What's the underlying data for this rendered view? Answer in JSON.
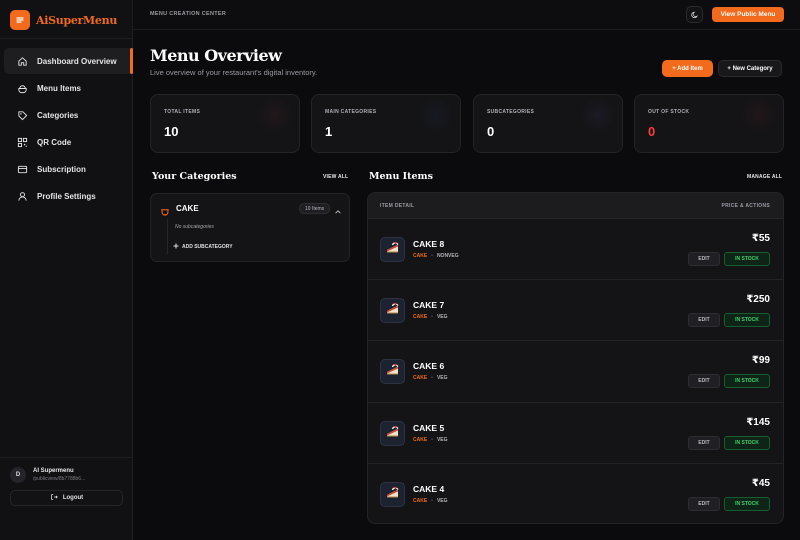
{
  "app": {
    "name": "AiSuperMenu"
  },
  "sidebar": {
    "items": [
      {
        "label": "Dashboard Overview",
        "icon": "home-icon"
      },
      {
        "label": "Menu Items",
        "icon": "bowl-icon"
      },
      {
        "label": "Categories",
        "icon": "tag-icon"
      },
      {
        "label": "QR Code",
        "icon": "qr-icon"
      },
      {
        "label": "Subscription",
        "icon": "card-icon"
      },
      {
        "label": "Profile Settings",
        "icon": "user-icon"
      }
    ],
    "active_index": 0,
    "user": {
      "initial": "D",
      "name": "AI Supermenu",
      "link": "/publicview/8b7788b6..."
    },
    "logout_label": "Logout"
  },
  "topbar": {
    "title": "MENU CREATION CENTER",
    "public_button": "View Public Menu",
    "theme_icon": "moon-icon"
  },
  "header": {
    "title": "Menu Overview",
    "subtitle": "Live overview of your restaurant's digital inventory.",
    "add_item_label": "+ Add Item",
    "new_category_label": "+ New Category"
  },
  "stats": [
    {
      "label": "TOTAL ITEMS",
      "value": "10",
      "color": "#ffffff"
    },
    {
      "label": "MAIN CATEGORIES",
      "value": "1",
      "color": "#ffffff"
    },
    {
      "label": "SUBCATEGORIES",
      "value": "0",
      "color": "#ffffff"
    },
    {
      "label": "OUT OF STOCK",
      "value": "0",
      "color": "#ff3b3b"
    }
  ],
  "categories": {
    "title": "Your Categories",
    "view_all": "VIEW ALL",
    "items": [
      {
        "name": "CAKE",
        "count": "10 Items",
        "empty_text": "No subcategories",
        "add_sub_label": "ADD SUBCATEGORY"
      }
    ]
  },
  "menu": {
    "title": "Menu Items",
    "manage_all": "MANAGE ALL",
    "col_left": "ITEM DETAIL",
    "col_right": "PRICE & ACTIONS",
    "edit_label": "EDIT",
    "items": [
      {
        "name": "CAKE 8",
        "category": "CAKE",
        "type": "NONVEG",
        "price": "₹55",
        "status": "IN STOCK"
      },
      {
        "name": "CAKE 7",
        "category": "CAKE",
        "type": "VEG",
        "price": "₹250",
        "status": "IN STOCK"
      },
      {
        "name": "CAKE 6",
        "category": "CAKE",
        "type": "VEG",
        "price": "₹99",
        "status": "IN STOCK"
      },
      {
        "name": "CAKE 5",
        "category": "CAKE",
        "type": "VEG",
        "price": "₹145",
        "status": "IN STOCK"
      },
      {
        "name": "CAKE 4",
        "category": "CAKE",
        "type": "VEG",
        "price": "₹45",
        "status": "IN STOCK"
      }
    ]
  },
  "colors": {
    "accent": "#f26a1b",
    "in_stock": "#36d36c",
    "danger": "#ff3b3b"
  }
}
